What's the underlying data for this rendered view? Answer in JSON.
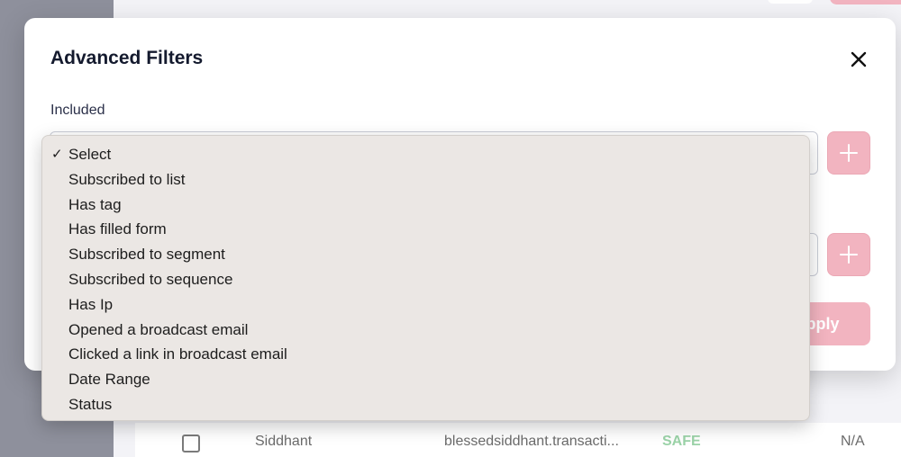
{
  "modal": {
    "title": "Advanced Filters",
    "included_label": "Included",
    "apply_label": "Apply",
    "close_icon": "close-icon",
    "add_icon": "plus-icon"
  },
  "dropdown": {
    "selected": "Select",
    "options": [
      "Select",
      "Subscribed to list",
      "Has tag",
      "Has filled form",
      "Subscribed to segment",
      "Subscribed to sequence",
      "Has Ip",
      "Opened a broadcast email",
      "Clicked a link in broadcast email",
      "Date Range",
      "Status"
    ]
  },
  "background_table": {
    "row": {
      "name": "Siddhant",
      "email": "blessedsiddhant.transacti...",
      "status": "SAFE",
      "extra": "N/A"
    }
  },
  "colors": {
    "accent_pink": "#f2b4c0",
    "status_safe": "#9bd3a8",
    "sidebar": "#8e909c",
    "dropdown_bg": "#ebe7e4"
  }
}
